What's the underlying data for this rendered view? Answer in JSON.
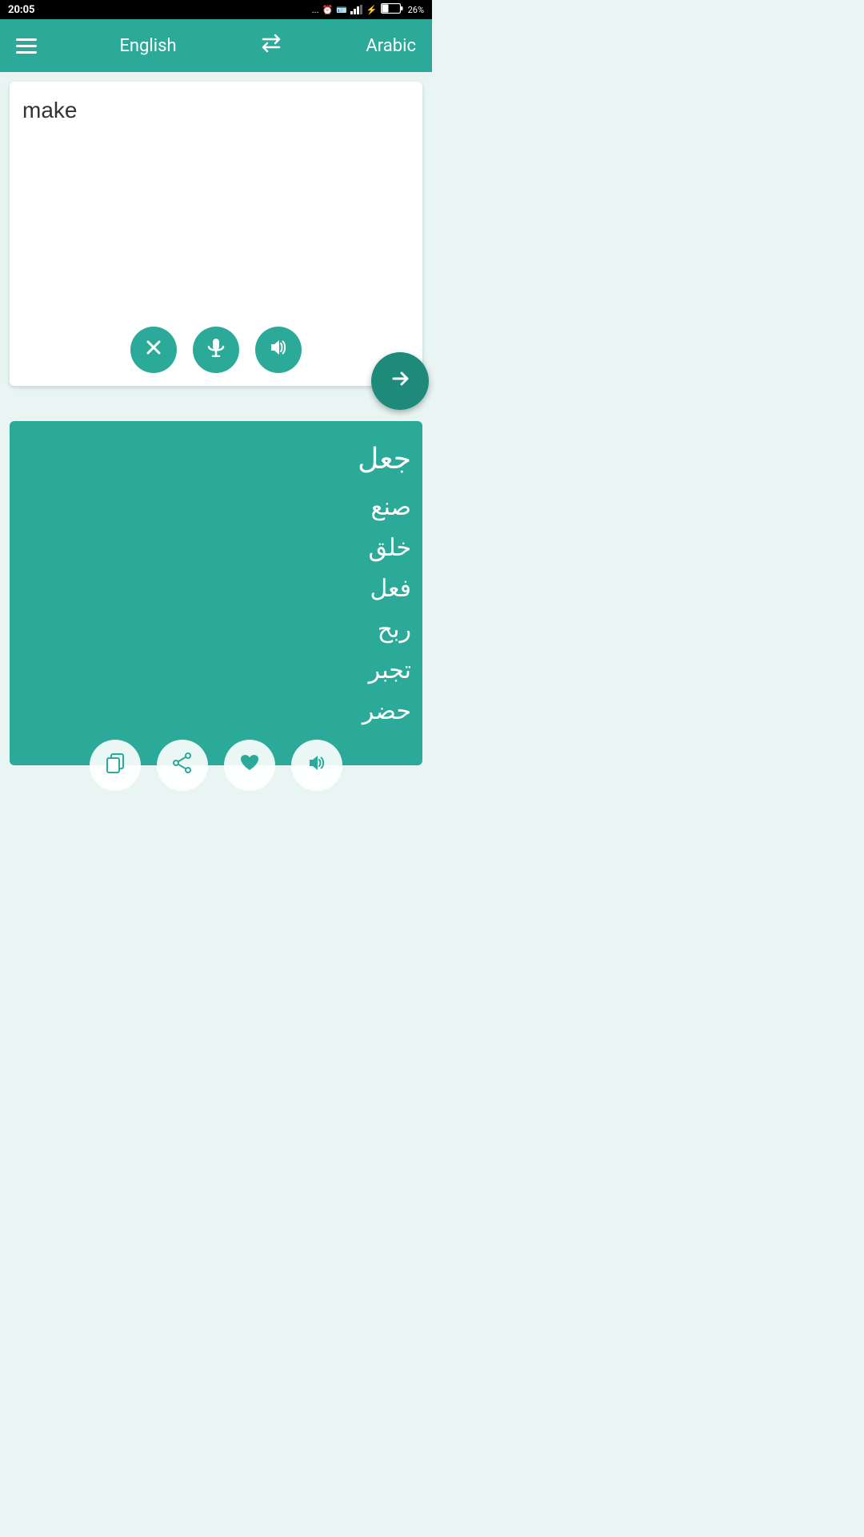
{
  "statusBar": {
    "time": "20:05",
    "dots": "...",
    "batteryPercent": "26%"
  },
  "navbar": {
    "sourceLang": "English",
    "targetLang": "Arabic",
    "swapLabel": "swap languages"
  },
  "inputSection": {
    "placeholder": "",
    "currentText": "make",
    "clearLabel": "clear",
    "micLabel": "microphone",
    "speakLabel": "speak",
    "translateLabel": "translate"
  },
  "outputSection": {
    "mainWord": "جعل",
    "alternateWords": "صنع\nخلق\nفعل\nربح\nتجبر\nحضر",
    "copyLabel": "copy",
    "shareLabel": "share",
    "favoriteLabel": "favorite",
    "audioLabel": "audio"
  }
}
